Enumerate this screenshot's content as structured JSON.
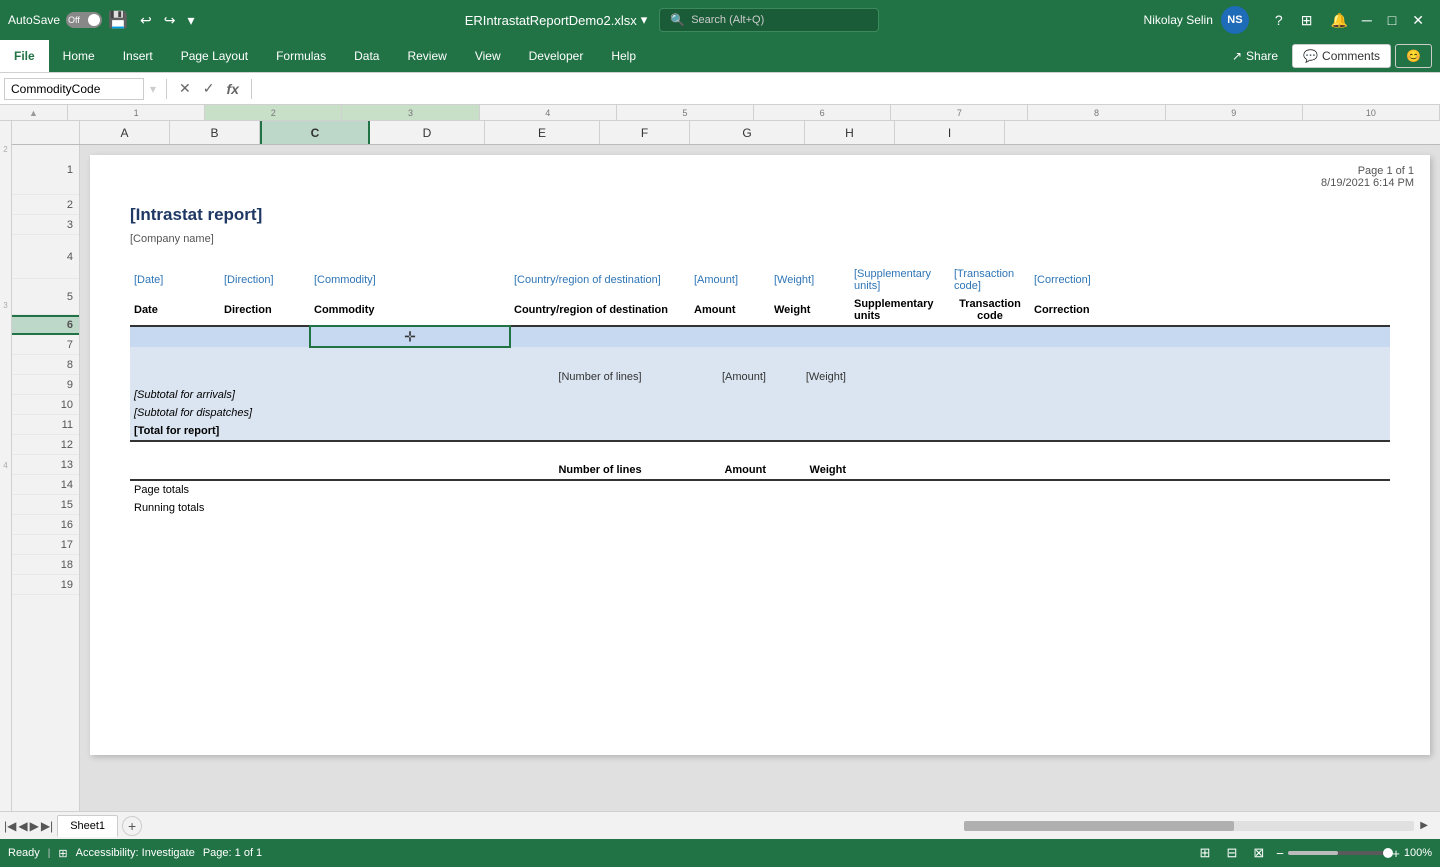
{
  "titleBar": {
    "autosave_label": "AutoSave",
    "autosave_state": "Off",
    "filename": "ERIntrastatReportDemo2.xlsx",
    "search_placeholder": "Search (Alt+Q)",
    "user_name": "Nikolay Selin",
    "user_initials": "NS",
    "minimize": "─",
    "maximize": "□",
    "close": "✕"
  },
  "ribbon": {
    "tabs": [
      "File",
      "Home",
      "Insert",
      "Page Layout",
      "Formulas",
      "Data",
      "Review",
      "View",
      "Developer",
      "Help"
    ],
    "active_tab": "Home",
    "share_label": "Share",
    "comments_label": "Comments"
  },
  "formulaBar": {
    "name_box": "CommodityCode",
    "cancel_btn": "✕",
    "confirm_btn": "✓",
    "fx_btn": "fx"
  },
  "columnHeaders": [
    "A",
    "B",
    "C",
    "D",
    "E",
    "F",
    "G",
    "H",
    "I"
  ],
  "rowNumbers": [
    "1",
    "2",
    "3",
    "4",
    "5",
    "6",
    "7",
    "8",
    "9",
    "10",
    "11",
    "12",
    "13",
    "14",
    "15",
    "16",
    "17",
    "18",
    "19"
  ],
  "rulerMarks": [
    "1",
    "2",
    "3",
    "4",
    "5",
    "6",
    "7",
    "8",
    "9",
    "10"
  ],
  "report": {
    "page_info_line1": "Page 1 of  1",
    "page_info_line2": "8/19/2021 6:14 PM",
    "title": "[Intrastat report]",
    "company": "[Company name]",
    "header_row1": {
      "date": "[Date]",
      "direction": "[Direction]",
      "commodity": "[Commodity]",
      "country_region": "[Country/region of destination]",
      "amount": "[Amount]",
      "weight": "[Weight]",
      "supplementary_units": "[Supplementary units]",
      "transaction_code": "[Transaction code]",
      "correction": "[Correction]"
    },
    "header_row2": {
      "date": "Date",
      "direction": "Direction",
      "commodity": "Commodity",
      "country_region": "Country/region of destination",
      "amount": "Amount",
      "weight": "Weight",
      "supplementary_units": "Supplementary units",
      "transaction_code": "Transaction code",
      "correction": "Correction"
    },
    "data_row6": {
      "cells": [
        "",
        "",
        "",
        "",
        "",
        "",
        "",
        "",
        ""
      ]
    },
    "row8": {
      "number_of_lines": "[Number of lines]",
      "amount": "[Amount]",
      "weight": "[Weight]"
    },
    "row9": {
      "label": "[Subtotal for arrivals]"
    },
    "row10": {
      "label": "[Subtotal for dispatches]"
    },
    "row11": {
      "label": "[Total for report]"
    },
    "summary_header": {
      "number_of_lines": "Number of lines",
      "amount": "Amount",
      "weight": "Weight"
    },
    "page_totals": {
      "label": "Page totals"
    },
    "running_totals": {
      "label": "Running totals"
    }
  },
  "sheetTabs": {
    "tabs": [
      "Sheet1"
    ],
    "active_tab": "Sheet1",
    "add_label": "+"
  },
  "statusBar": {
    "ready": "Ready",
    "accessibility": "Accessibility: Investigate",
    "page_info": "Page: 1 of 1",
    "view_normal": "⊞",
    "view_page": "⊟",
    "view_custom": "⊠",
    "zoom_out": "−",
    "zoom_in": "+",
    "zoom_level": "100%"
  },
  "activeCell": "C6",
  "activeCellDisplay": "CommodityCode"
}
